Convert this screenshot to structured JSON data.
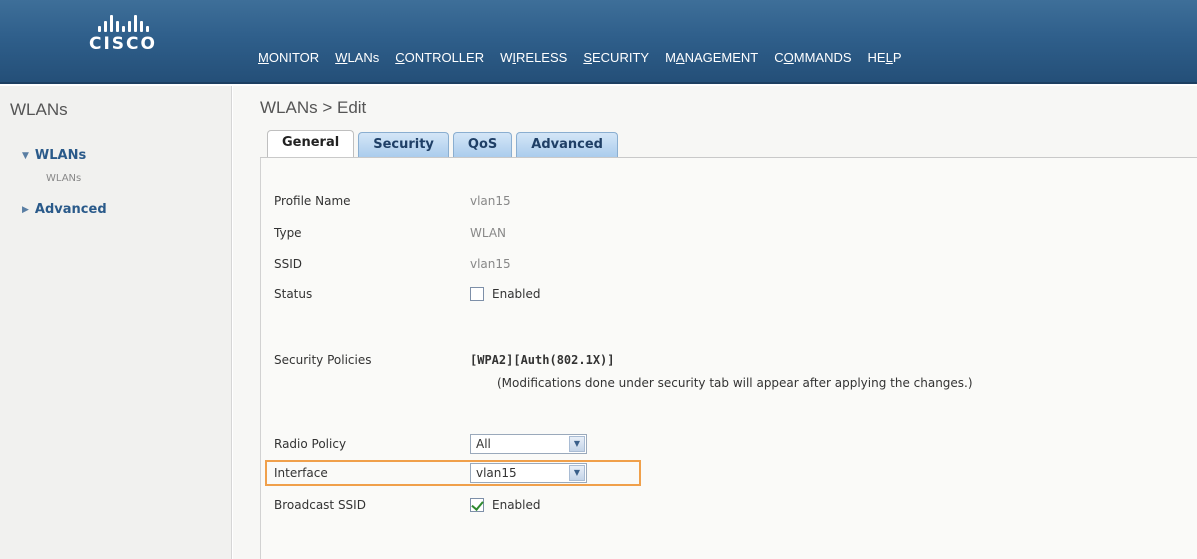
{
  "header": {
    "logo_text": "CISCO",
    "nav": [
      {
        "pre": "",
        "ul": "M",
        "post": "ONITOR"
      },
      {
        "pre": "",
        "ul": "W",
        "post": "LANs"
      },
      {
        "pre": "",
        "ul": "C",
        "post": "ONTROLLER"
      },
      {
        "pre": "W",
        "ul": "I",
        "post": "RELESS"
      },
      {
        "pre": "",
        "ul": "S",
        "post": "ECURITY"
      },
      {
        "pre": "M",
        "ul": "A",
        "post": "NAGEMENT"
      },
      {
        "pre": "C",
        "ul": "O",
        "post": "MMANDS"
      },
      {
        "pre": "HE",
        "ul": "L",
        "post": "P"
      }
    ]
  },
  "sidebar": {
    "title": "WLANs",
    "items": [
      {
        "label": "WLANs",
        "expanded": true,
        "sub": "WLANs"
      },
      {
        "label": "Advanced",
        "expanded": false
      }
    ]
  },
  "main": {
    "title": "WLANs > Edit",
    "tabs": [
      "General",
      "Security",
      "QoS",
      "Advanced"
    ],
    "active_tab": "General",
    "fields": {
      "profile_name": {
        "label": "Profile Name",
        "value": "vlan15"
      },
      "type": {
        "label": "Type",
        "value": "WLAN"
      },
      "ssid": {
        "label": "SSID",
        "value": "vlan15"
      },
      "status": {
        "label": "Status",
        "checkbox_label": "Enabled",
        "checked": false
      },
      "security_policies": {
        "label": "Security Policies",
        "value": "[WPA2][Auth(802.1X)]",
        "note": "(Modifications done under security tab will appear after applying the changes.)"
      },
      "radio_policy": {
        "label": "Radio Policy",
        "value": "All"
      },
      "interface": {
        "label": "Interface",
        "value": "vlan15"
      },
      "broadcast_ssid": {
        "label": "Broadcast SSID",
        "checkbox_label": "Enabled",
        "checked": true
      }
    }
  },
  "colors": {
    "header_bg": "#2f5f8b",
    "highlight": "#f0a04b",
    "tab_bg": "#a9cbec",
    "link": "#2a5a8a"
  }
}
